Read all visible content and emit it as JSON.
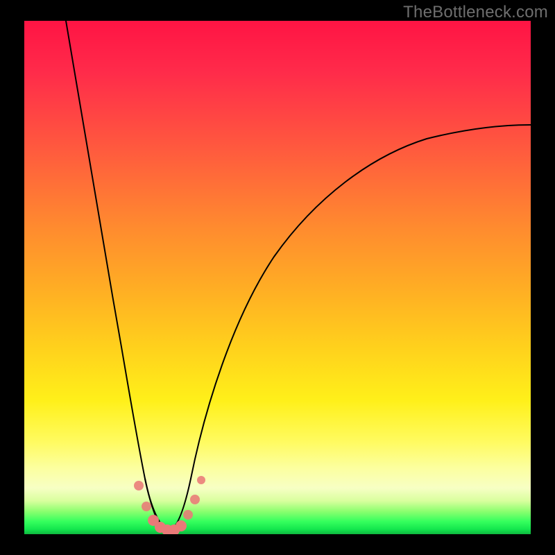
{
  "watermark": "TheBottleneck.com",
  "colors": {
    "page_bg": "#000000",
    "watermark": "#6e6e6e",
    "curve_stroke": "#000000",
    "marker_fill": "#e97a78",
    "gradient_top": "#ff1444",
    "gradient_mid1": "#ff8a2f",
    "gradient_mid2": "#fff01a",
    "gradient_bottom": "#14e84e"
  },
  "chart_data": {
    "type": "line",
    "title": "",
    "xlabel": "",
    "ylabel": "",
    "xlim": [
      0,
      100
    ],
    "ylim": [
      0,
      100
    ],
    "grid": false,
    "legend": false,
    "annotations": [
      "TheBottleneck.com"
    ],
    "series": [
      {
        "name": "bottleneck-curve",
        "x": [
          0,
          5,
          10,
          15,
          18,
          20,
          22,
          24,
          25,
          26,
          27,
          28,
          29,
          30,
          32,
          35,
          40,
          45,
          50,
          55,
          60,
          65,
          70,
          75,
          80,
          85,
          90,
          95,
          100
        ],
        "values": [
          100,
          85,
          65,
          40,
          23,
          12,
          6,
          2,
          1,
          0,
          0,
          0,
          1,
          2,
          6,
          13,
          25,
          35,
          43,
          50,
          56,
          61,
          65,
          68.5,
          71.5,
          74,
          76,
          77.5,
          79
        ]
      }
    ],
    "markers": {
      "name": "highlight-points",
      "x": [
        21.5,
        23.0,
        24.2,
        25.0,
        26.0,
        27.0,
        28.0,
        29.2,
        30.5,
        32.0
      ],
      "values": [
        9.0,
        5.0,
        2.5,
        1.3,
        0.7,
        0.4,
        0.5,
        1.0,
        2.2,
        5.0
      ]
    },
    "notes": "Values are percentages read from a bottleneck-style V-curve; minimum near x≈26–27 at y≈0. Right branch rises asymptotically toward ~80%."
  }
}
